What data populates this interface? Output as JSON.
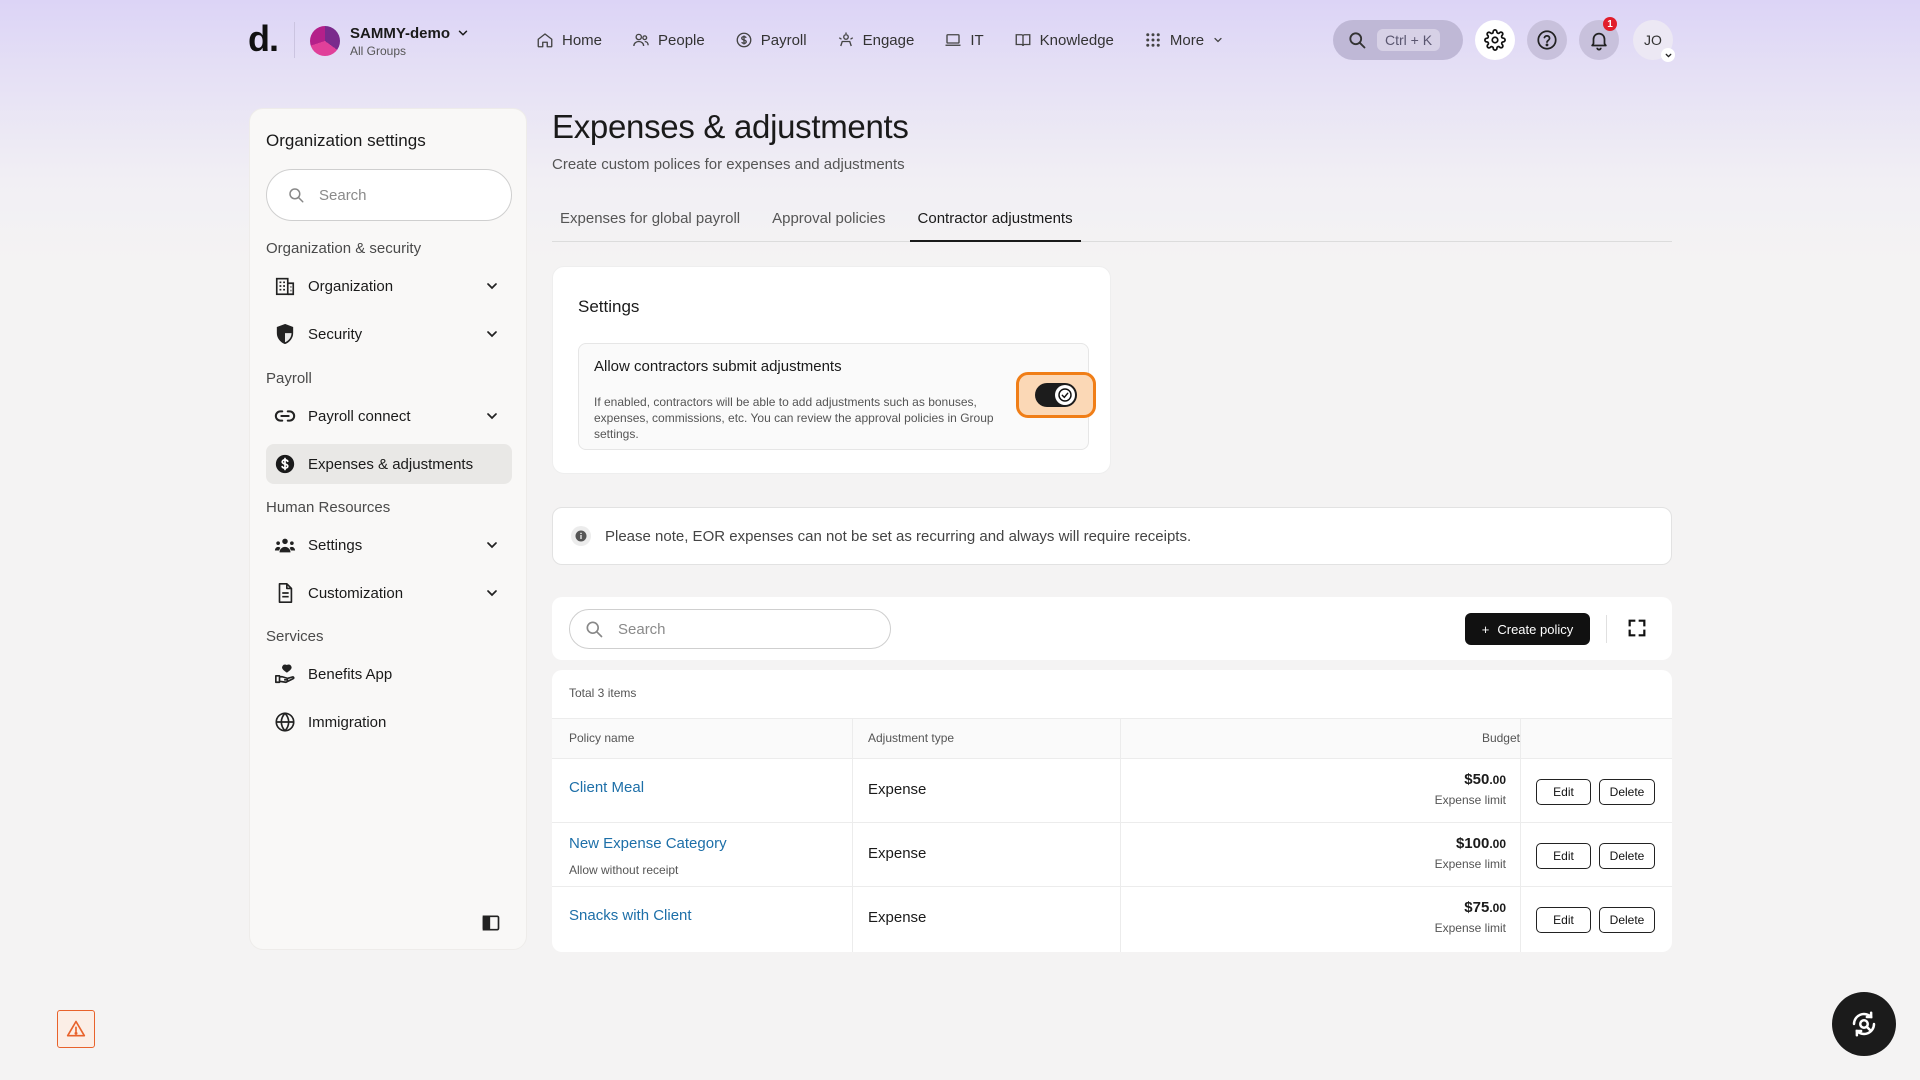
{
  "topnav": {
    "logo": "d.",
    "org_name": "SAMMY-demo",
    "org_sub": "All Groups",
    "items": [
      {
        "label": "Home",
        "icon": "home-icon"
      },
      {
        "label": "People",
        "icon": "people-icon"
      },
      {
        "label": "Payroll",
        "icon": "payroll-icon"
      },
      {
        "label": "Engage",
        "icon": "engage-icon"
      },
      {
        "label": "IT",
        "icon": "laptop-icon"
      },
      {
        "label": "Knowledge",
        "icon": "book-icon"
      },
      {
        "label": "More",
        "icon": "grid-icon"
      }
    ],
    "search_shortcut": "Ctrl + K",
    "notification_count": "1",
    "user_initials": "JO"
  },
  "sidebar": {
    "title": "Organization settings",
    "search_placeholder": "Search",
    "groups": [
      {
        "label": "Organization & security"
      },
      {
        "label": "Payroll"
      },
      {
        "label": "Human Resources"
      },
      {
        "label": "Services"
      }
    ],
    "items": [
      {
        "label": "Organization",
        "icon": "building-icon"
      },
      {
        "label": "Security",
        "icon": "shield-icon"
      },
      {
        "label": "Payroll connect",
        "icon": "link-icon"
      },
      {
        "label": "Expenses & adjustments",
        "icon": "dollar-icon",
        "active": true
      },
      {
        "label": "Settings",
        "icon": "team-icon"
      },
      {
        "label": "Customization",
        "icon": "document-icon"
      },
      {
        "label": "Benefits App",
        "icon": "benefits-icon"
      },
      {
        "label": "Immigration",
        "icon": "globe-icon"
      }
    ]
  },
  "main": {
    "title": "Expenses & adjustments",
    "subtitle": "Create custom polices for expenses and adjustments",
    "tabs": [
      {
        "label": "Expenses for global payroll"
      },
      {
        "label": "Approval policies"
      },
      {
        "label": "Contractor adjustments",
        "active": true
      }
    ],
    "settings": {
      "heading": "Settings",
      "option_title": "Allow contractors submit adjustments",
      "option_desc": "If enabled, contractors will be able to add adjustments such as bonuses, expenses, commissions, etc. You can review the approval policies in Group settings.",
      "toggle_on": true
    },
    "note": "Please note, EOR expenses can not be set as recurring and always will require receipts.",
    "toolbar": {
      "search_placeholder": "Search",
      "create_label": "Create policy"
    },
    "table": {
      "total": "Total 3 items",
      "columns": [
        "Policy name",
        "Adjustment type",
        "Budget"
      ],
      "rows": [
        {
          "name": "Client Meal",
          "sub": "",
          "type": "Expense",
          "amount": "$50",
          "cents": ".00",
          "budget_label": "Expense limit",
          "edit": "Edit",
          "delete": "Delete"
        },
        {
          "name": "New Expense Category",
          "sub": "Allow without receipt",
          "type": "Expense",
          "amount": "$100",
          "cents": ".00",
          "budget_label": "Expense limit",
          "edit": "Edit",
          "delete": "Delete"
        },
        {
          "name": "Snacks with Client",
          "sub": "",
          "type": "Expense",
          "amount": "$75",
          "cents": ".00",
          "budget_label": "Expense limit",
          "edit": "Edit",
          "delete": "Delete"
        }
      ]
    }
  },
  "colors": {
    "accent_orange": "#f07e17",
    "link_blue": "#1d6fa8",
    "primary_black": "#111111",
    "badge_red": "#e11d2a"
  }
}
